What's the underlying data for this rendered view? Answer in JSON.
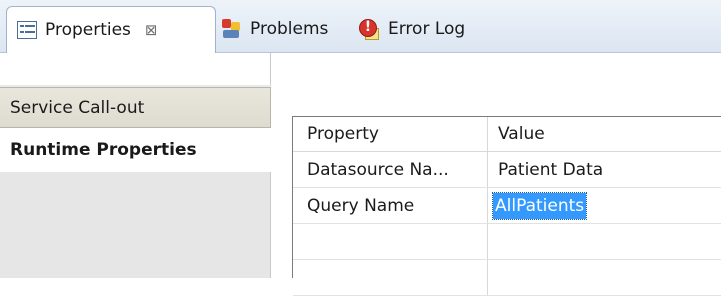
{
  "tabs": [
    {
      "label": "Properties",
      "icon": "properties-icon",
      "active": true,
      "close": "⊠"
    },
    {
      "label": "Problems",
      "icon": "problems-icon"
    },
    {
      "label": "Error Log",
      "icon": "error-log-icon"
    }
  ],
  "sidebar": {
    "items": [
      {
        "label": "Service Call-out",
        "selected": false
      },
      {
        "label": "Runtime Properties",
        "selected": true
      }
    ]
  },
  "table": {
    "columns": [
      "Property",
      "Value"
    ],
    "rows": [
      {
        "property": "Datasource Na...",
        "value": "Patient Data"
      },
      {
        "property": "Query Name",
        "value": "AllPatients",
        "editing": true
      },
      {
        "property": "",
        "value": ""
      },
      {
        "property": "",
        "value": ""
      }
    ]
  },
  "colors": {
    "selection": "#3399ff",
    "tabbar": "#dbe6f2"
  }
}
